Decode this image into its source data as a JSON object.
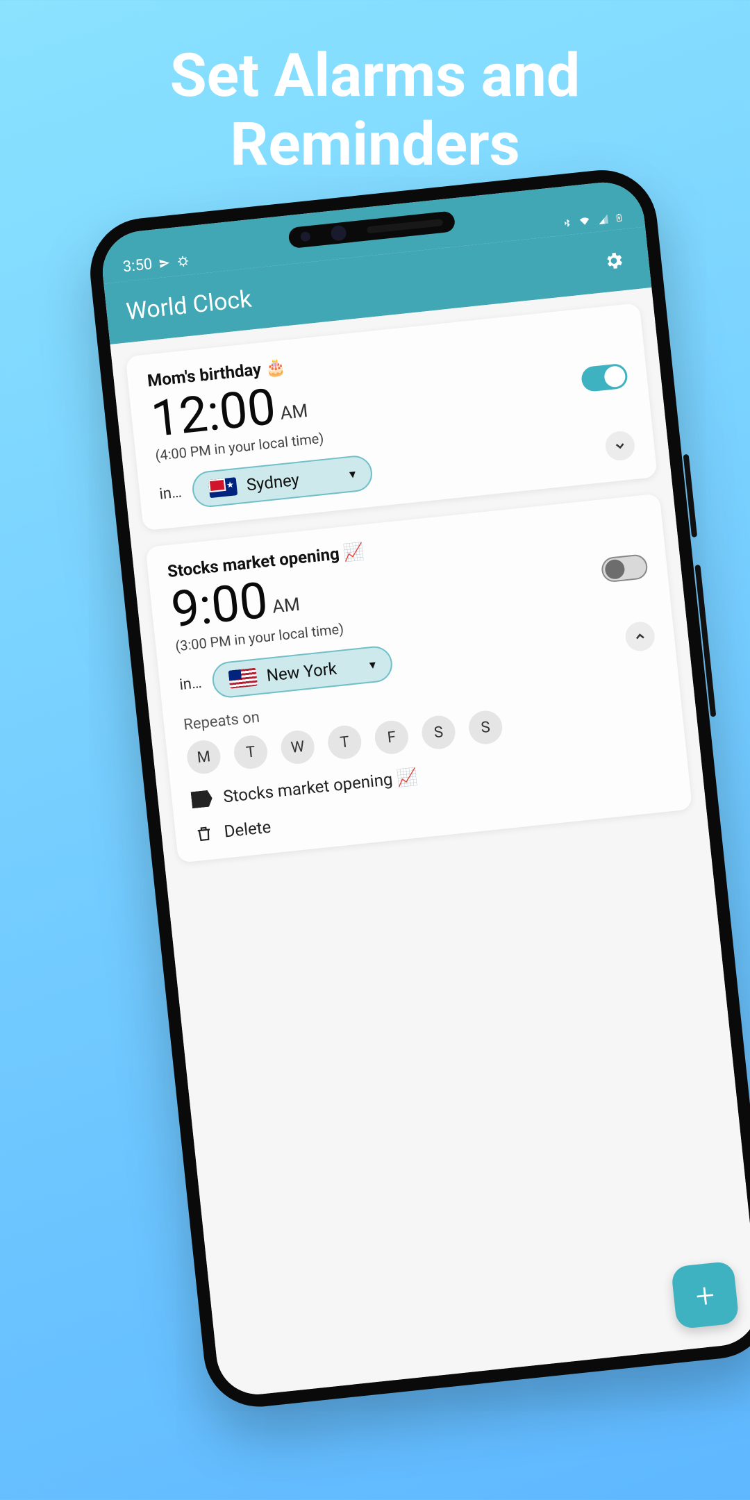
{
  "promo": {
    "heading": "Set Alarms and Reminders"
  },
  "status": {
    "time": "3:50"
  },
  "app": {
    "title": "World Clock"
  },
  "alarms": [
    {
      "title": "Mom's birthday 🎂",
      "time": "12:00",
      "ampm": "AM",
      "local_note": "(4:00 PM in your local time)",
      "in_label": "in…",
      "city": "Sydney",
      "flag": "au",
      "enabled": true,
      "expanded": false
    },
    {
      "title": "Stocks market opening 📈",
      "time": "9:00",
      "ampm": "AM",
      "local_note": "(3:00 PM in your local time)",
      "in_label": "in…",
      "city": "New York",
      "flag": "us",
      "enabled": false,
      "expanded": true,
      "repeats_label": "Repeats on",
      "days": [
        "M",
        "T",
        "W",
        "T",
        "F",
        "S",
        "S"
      ],
      "label_text": "Stocks market opening 📈",
      "delete_label": "Delete"
    }
  ],
  "fab": {
    "plus": "+"
  }
}
